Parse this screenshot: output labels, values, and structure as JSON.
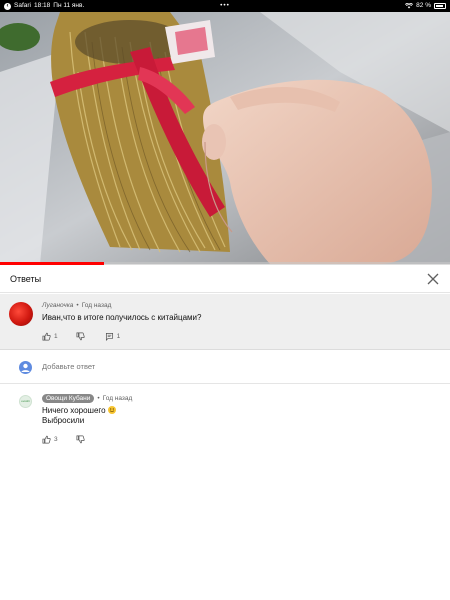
{
  "status_bar": {
    "back_app": "Safari",
    "time": "18:18",
    "date": "Пн 11 янв.",
    "battery_percent": "82 %",
    "back_icon": "chevron-left-icon",
    "wifi_icon": "wifi-icon",
    "battery_icon": "battery-icon"
  },
  "video": {
    "progress": 0.23,
    "progress_color": "#ff0000"
  },
  "replies_panel": {
    "title": "Ответы",
    "close_icon": "close-icon"
  },
  "parent_comment": {
    "author": "Луганочка",
    "time": "Год назад",
    "text": "Иван,что в итоге получилось с китайцами?",
    "likes": "1",
    "replies": "1"
  },
  "add_reply": {
    "placeholder": "Добавьте ответ"
  },
  "reply": {
    "author": "Овощи Кубани",
    "avatar_text": "ovoshi",
    "time": "Год назад",
    "text_line1": "Ничего хорошего",
    "text_line2": "Выбросили",
    "likes": "3"
  }
}
